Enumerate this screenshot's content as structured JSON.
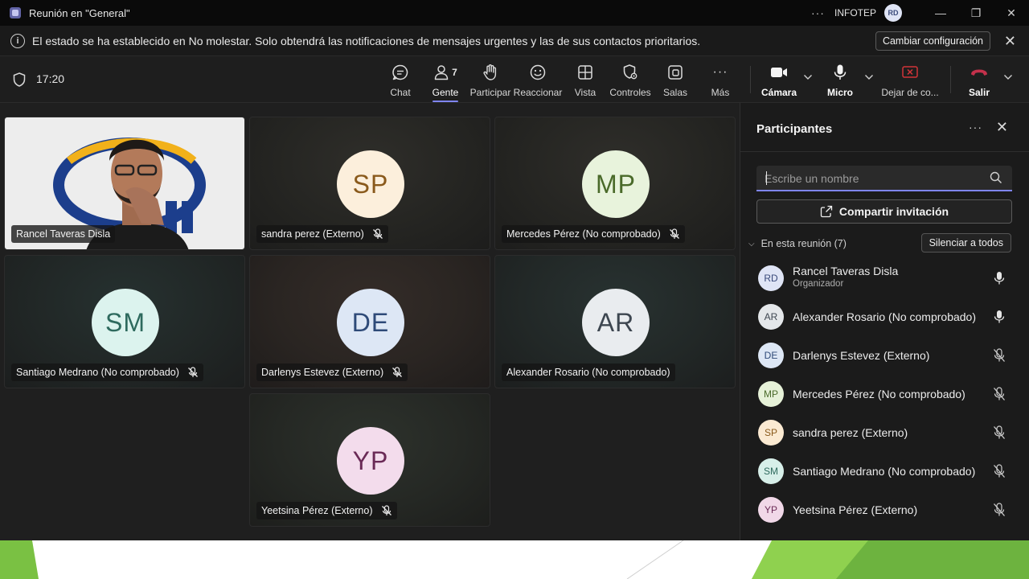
{
  "titlebar": {
    "title": "Reunión en \"General\"",
    "more_label": "···",
    "org": "INFOTEP",
    "avatar_initials": "RD",
    "minimize": "—",
    "restore": "❐",
    "close": "✕"
  },
  "banner": {
    "info_glyph": "i",
    "text": "El estado se ha establecido en No molestar. Solo obtendrá las notificaciones de mensajes urgentes y las de sus contactos prioritarios.",
    "button": "Cambiar configuración",
    "close": "✕"
  },
  "toolbar": {
    "time": "17:20",
    "people_count": "7",
    "items": {
      "chat": "Chat",
      "people": "Gente",
      "raise": "Participar",
      "react": "Reaccionar",
      "view": "Vista",
      "controls": "Controles",
      "rooms": "Salas",
      "more": "Más",
      "more_glyph": "···",
      "camera": "Cámara",
      "mic": "Micro",
      "share": "Dejar de co...",
      "leave": "Salir"
    },
    "leave_color": "#c4314b"
  },
  "tiles": [
    {
      "name": "Rancel Taveras Disla",
      "initials": "",
      "video": true
    },
    {
      "name": "sandra perez (Externo)",
      "initials": "SP",
      "bg": "#fcefdc",
      "fg": "#8a5a1c",
      "muted": true
    },
    {
      "name": "Mercedes Pérez (No comprobado)",
      "initials": "MP",
      "bg": "#e8f3dc",
      "fg": "#4a6a2a",
      "muted": true
    },
    {
      "name": "Santiago Medrano (No comprobado)",
      "initials": "SM",
      "bg": "#dcf3ee",
      "fg": "#2e6a5e",
      "muted": true
    },
    {
      "name": "Darlenys Estevez (Externo)",
      "initials": "DE",
      "bg": "#dde7f5",
      "fg": "#2e4a78",
      "muted": true
    },
    {
      "name": "Alexander Rosario (No comprobado)",
      "initials": "AR",
      "bg": "#e9ecef",
      "fg": "#3d4650",
      "muted": false
    },
    {
      "name": "Yeetsina Pérez (Externo)",
      "initials": "YP",
      "bg": "#f3dcec",
      "fg": "#6a2a56",
      "muted": true
    }
  ],
  "panel": {
    "title": "Participantes",
    "more": "···",
    "close": "✕",
    "search_placeholder": "Escribe un nombre",
    "share_label": "Compartir invitación",
    "section_arrow": "⌵",
    "section_label": "En esta reunión (7)",
    "mute_all": "Silenciar a todos",
    "participants": [
      {
        "initials": "RD",
        "name": "Rancel Taveras Disla",
        "role": "Organizador",
        "bg": "#dfe4f5",
        "fg": "#3a4a7a",
        "mic": "on"
      },
      {
        "initials": "AR",
        "name": "Alexander Rosario (No comprobado)",
        "role": "",
        "bg": "#e4e7ea",
        "fg": "#3d4650",
        "mic": "on"
      },
      {
        "initials": "DE",
        "name": "Darlenys Estevez (Externo)",
        "role": "",
        "bg": "#dde7f5",
        "fg": "#2e4a78",
        "mic": "off"
      },
      {
        "initials": "MP",
        "name": "Mercedes Pérez (No comprobado)",
        "role": "",
        "bg": "#e6f1d8",
        "fg": "#4a6a2a",
        "mic": "off"
      },
      {
        "initials": "SP",
        "name": "sandra perez (Externo)",
        "role": "",
        "bg": "#fbead2",
        "fg": "#8a5a1c",
        "mic": "off"
      },
      {
        "initials": "SM",
        "name": "Santiago Medrano (No comprobado)",
        "role": "",
        "bg": "#d7efe9",
        "fg": "#2e6a5e",
        "mic": "off"
      },
      {
        "initials": "YP",
        "name": "Yeetsina Pérez (Externo)",
        "role": "",
        "bg": "#f1d8e8",
        "fg": "#6a2a56",
        "mic": "off"
      }
    ]
  },
  "colors": {
    "accent": "#7f85f5",
    "slide_green": "#7ac143"
  }
}
